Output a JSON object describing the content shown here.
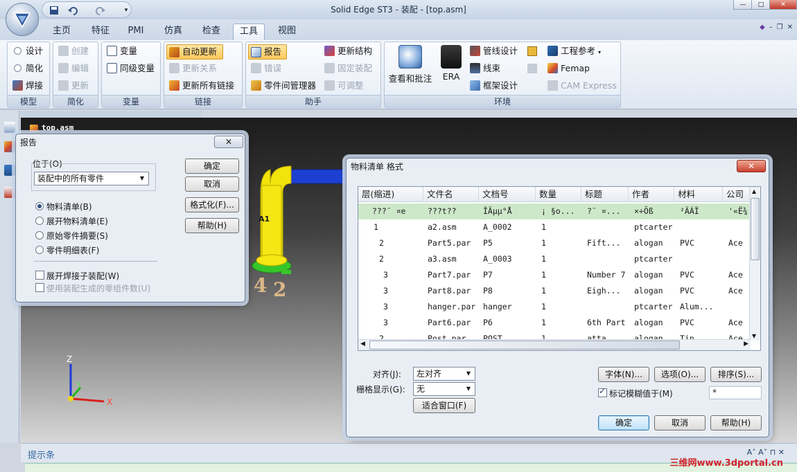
{
  "window": {
    "title_app": "Solid Edge ST3",
    "title_doc": "装配 - [top.asm]",
    "btn_min": "—",
    "btn_max": "□",
    "btn_close": "✕"
  },
  "tabs": [
    "主页",
    "特征",
    "PMI",
    "仿真",
    "检查",
    "工具",
    "视图"
  ],
  "active_tab": "工具",
  "ribbon_right": [
    "◆",
    "–",
    "❐",
    "✕"
  ],
  "groups": {
    "model": {
      "label": "模型",
      "items": [
        "设计",
        "简化",
        "焊接"
      ]
    },
    "simplify": {
      "label": "简化",
      "items": [
        "创建",
        "编辑",
        "更新"
      ]
    },
    "variables": {
      "label": "变量",
      "items": [
        "变量",
        "同级变量"
      ]
    },
    "links": {
      "label": "链接",
      "items": [
        "自动更新",
        "更新关系",
        "更新所有链接"
      ]
    },
    "assistant": {
      "label": "助手",
      "items": [
        "报告",
        "错误",
        "零件间管理器",
        "更新结构",
        "固定装配",
        "可调整"
      ]
    },
    "environment": {
      "label": "环境",
      "items": [
        "查看和批注",
        "ERA",
        "管线设计",
        "线束",
        "框架设计",
        "工程参考",
        "Femap",
        "CAM Express"
      ]
    }
  },
  "viewport": {
    "doc_tab": "top.asm",
    "status_label": "提示条",
    "watermark": "三维网www.3dportal.cn",
    "axis": {
      "z": "Z",
      "y": "Y",
      "x": "X"
    },
    "model_labels": [
      "A1",
      "4",
      "2"
    ]
  },
  "report_dialog": {
    "title": "报告",
    "location_label": "位于(O)",
    "location_value": "装配中的所有零件",
    "options": [
      "物料清单(B)",
      "展开物料清单(E)",
      "原始零件摘要(S)",
      "零件明细表(F)"
    ],
    "selected_option": 0,
    "expand_weldment": "展开焊接子装配(W)",
    "use_generated_count": "使用装配生成的零组件数(U)",
    "btn_ok": "确定",
    "btn_cancel": "取消",
    "btn_format": "格式化(F)...",
    "btn_help": "帮助(H)",
    "close": "✕"
  },
  "bom_dialog": {
    "title": "物料清单 格式",
    "close": "✕",
    "columns": [
      "层(缩进)",
      "文件名",
      "文档号",
      "数量",
      "标题",
      "作者",
      "材料",
      "公司"
    ],
    "rows": [
      [
        "???¨ ¤e",
        "???t??",
        "ÎÄµµ°Å",
        "¡ §o...",
        "?¨ ¤...",
        "×÷Õß",
        "²ÄÁÏ",
        "'«Ë¾"
      ],
      [
        "1",
        "a2.asm",
        "A_0002",
        "1",
        "",
        "ptcarter",
        "",
        ""
      ],
      [
        "2",
        "Part5.par",
        "P5",
        "1",
        "Fift...",
        "alogan",
        "PVC",
        "Ace"
      ],
      [
        "2",
        "a3.asm",
        "A_0003",
        "1",
        "",
        "ptcarter",
        "",
        ""
      ],
      [
        "3",
        "Part7.par",
        "P7",
        "1",
        "Number 7",
        "alogan",
        "PVC",
        "Ace"
      ],
      [
        "3",
        "Part8.par",
        "P8",
        "1",
        "Eigh...",
        "alogan",
        "PVC",
        "Ace"
      ],
      [
        "3",
        "hanger.par",
        "hanger",
        "1",
        "",
        "ptcarter",
        "Alum...",
        ""
      ],
      [
        "3",
        "Part6.par",
        "P6",
        "1",
        "6th Part",
        "alogan",
        "PVC",
        "Ace"
      ],
      [
        "2",
        "Post.par",
        "POST",
        "1",
        "atta...",
        "alogan",
        "Tin",
        "Ace"
      ]
    ],
    "align_label": "对齐(J):",
    "align_value": "左对齐",
    "grid_label": "栅格显示(G):",
    "grid_value": "无",
    "btn_fit": "适合窗口(F)",
    "btn_font": "字体(N)...",
    "btn_options": "选项(O)...",
    "btn_sort": "排序(S)...",
    "mark_fuzzy": "标记模糊值于(M)",
    "fuzzy_value": "*",
    "btn_ok": "确定",
    "btn_cancel": "取消",
    "btn_help": "帮助(H)"
  }
}
